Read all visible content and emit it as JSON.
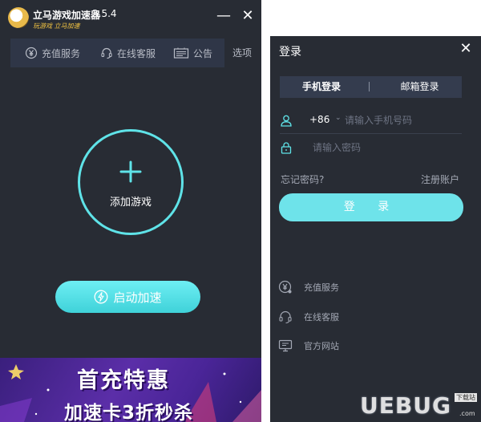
{
  "app": {
    "name": "立马游戏加速器",
    "version": "3.5.4",
    "slogan": "玩游戏  立马加速"
  },
  "window_controls": {
    "minimize": "—",
    "close": "✕"
  },
  "nav": {
    "items": [
      {
        "label": "充值服务",
        "icon": "yen-circle-icon"
      },
      {
        "label": "在线客服",
        "icon": "headset-icon"
      },
      {
        "label": "公告",
        "icon": "announcement-icon"
      }
    ],
    "options_label": "选项"
  },
  "main": {
    "add_game_label": "添加游戏",
    "start_button_label": "启动加速"
  },
  "banner": {
    "line1": "首充特惠",
    "line2": "加速卡3折秒杀"
  },
  "login": {
    "title": "登录",
    "close": "✕",
    "tabs": [
      "手机登录",
      "邮箱登录"
    ],
    "country_code": "+86",
    "phone_placeholder": "请输入手机号码",
    "password_placeholder": "请输入密码",
    "forgot_password": "忘记密码?",
    "register": "注册账户",
    "login_button": "登 录"
  },
  "side_links": [
    {
      "label": "充值服务",
      "icon": "yen-circle-icon"
    },
    {
      "label": "在线客服",
      "icon": "headset-icon"
    },
    {
      "label": "官方网站",
      "icon": "monitor-icon"
    }
  ],
  "watermark": {
    "text": "UEBUG",
    "tag": "下载站",
    "domain": ".com"
  },
  "colors": {
    "accent": "#5fe3e8",
    "background": "#282c34",
    "nav_bg": "#2f3647",
    "tab_bg": "#343c4e"
  }
}
